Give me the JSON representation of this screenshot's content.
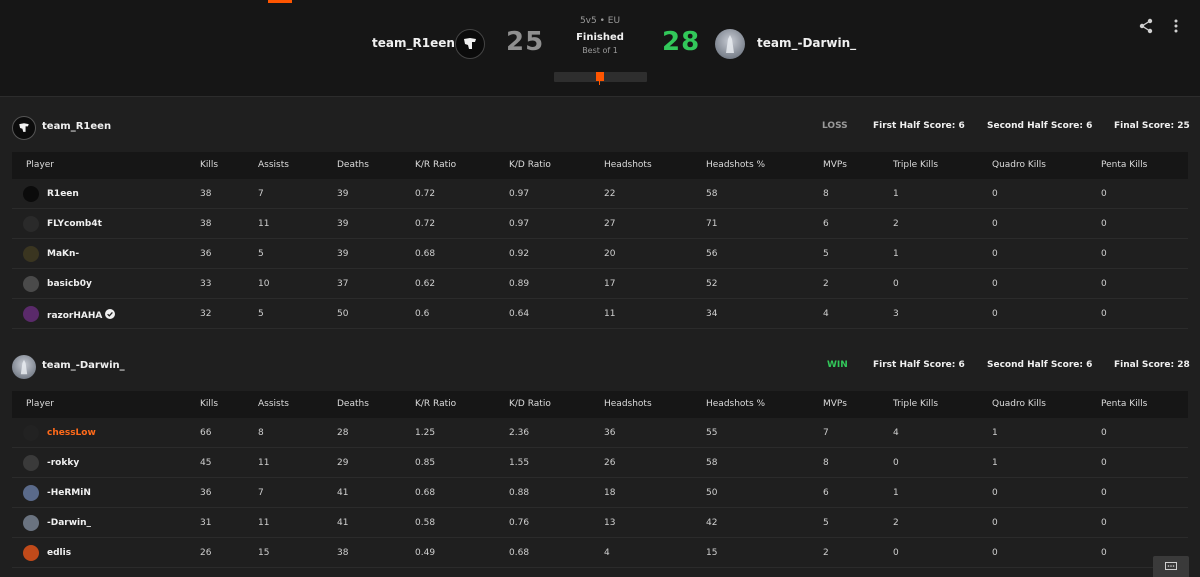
{
  "header": {
    "team1": {
      "name": "team_R1een",
      "score": "25"
    },
    "team2": {
      "name": "team_-Darwin_",
      "score": "28"
    },
    "format": "5v5 • EU",
    "status": "Finished",
    "best_of": "Best of 1"
  },
  "columns": [
    "Player",
    "Kills",
    "Assists",
    "Deaths",
    "K/R Ratio",
    "K/D Ratio",
    "Headshots",
    "Headshots %",
    "MVPs",
    "Triple Kills",
    "Quadro Kills",
    "Penta Kills"
  ],
  "teams": [
    {
      "name": "team_R1een",
      "result": "LOSS",
      "result_color": "#9a9a9a",
      "first_half": "First Half Score: 6",
      "second_half": "Second Half Score: 6",
      "final": "Final Score: 25",
      "players": [
        {
          "name": "R1een",
          "stats": [
            "38",
            "7",
            "39",
            "0.72",
            "0.97",
            "22",
            "58",
            "8",
            "1",
            "0",
            "0"
          ]
        },
        {
          "name": "FLYcomb4t",
          "stats": [
            "38",
            "11",
            "39",
            "0.72",
            "0.97",
            "27",
            "71",
            "6",
            "2",
            "0",
            "0"
          ]
        },
        {
          "name": "MaKn-",
          "stats": [
            "36",
            "5",
            "39",
            "0.68",
            "0.92",
            "20",
            "56",
            "5",
            "1",
            "0",
            "0"
          ]
        },
        {
          "name": "basicb0y",
          "stats": [
            "33",
            "10",
            "37",
            "0.62",
            "0.89",
            "17",
            "52",
            "2",
            "0",
            "0",
            "0"
          ]
        },
        {
          "name": "razorHAHA",
          "stats": [
            "32",
            "5",
            "50",
            "0.6",
            "0.64",
            "11",
            "34",
            "4",
            "3",
            "0",
            "0"
          ]
        }
      ]
    },
    {
      "name": "team_-Darwin_",
      "result": "WIN",
      "result_color": "#32c85a",
      "first_half": "First Half Score: 6",
      "second_half": "Second Half Score: 6",
      "final": "Final Score: 28",
      "players": [
        {
          "name": "chessLow",
          "stats": [
            "66",
            "8",
            "28",
            "1.25",
            "2.36",
            "36",
            "55",
            "7",
            "4",
            "1",
            "0"
          ]
        },
        {
          "name": "-rokky",
          "stats": [
            "45",
            "11",
            "29",
            "0.85",
            "1.55",
            "26",
            "58",
            "8",
            "0",
            "1",
            "0"
          ]
        },
        {
          "name": "-HeRMiN",
          "stats": [
            "36",
            "7",
            "41",
            "0.68",
            "0.88",
            "18",
            "50",
            "6",
            "1",
            "0",
            "0"
          ]
        },
        {
          "name": "-Darwin_",
          "stats": [
            "31",
            "11",
            "41",
            "0.58",
            "0.76",
            "13",
            "42",
            "5",
            "2",
            "0",
            "0"
          ]
        },
        {
          "name": "edlis",
          "stats": [
            "26",
            "15",
            "38",
            "0.49",
            "0.68",
            "4",
            "15",
            "2",
            "0",
            "0",
            "0"
          ]
        }
      ]
    }
  ],
  "colors": {
    "accent": "#ff5500",
    "win": "#32c85a",
    "highlight_player": "#ff6a1a"
  }
}
